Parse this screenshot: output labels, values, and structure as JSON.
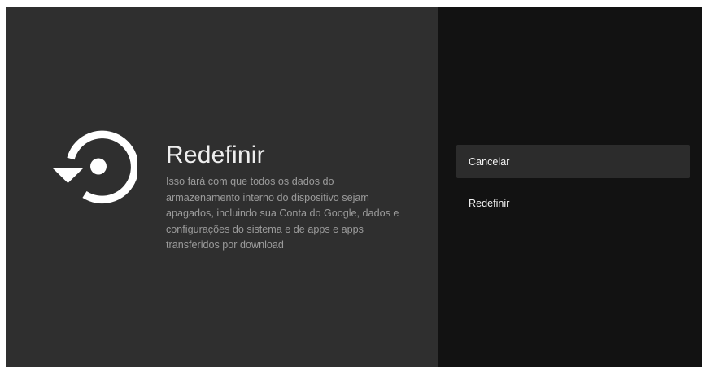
{
  "dialog": {
    "title": "Redefinir",
    "description": "Isso fará com que todos os dados do armazenamento interno do dispositivo sejam apagados, incluindo sua Conta do Google, dados e configurações do sistema e de apps e apps transferidos por download",
    "icon": "restore-icon"
  },
  "actions": [
    {
      "label": "Cancelar",
      "focused": true
    },
    {
      "label": "Redefinir",
      "focused": false
    }
  ],
  "colors": {
    "left_pane": "#2f2f2f",
    "right_pane": "#121212",
    "focused_item": "#2c2c2c"
  }
}
